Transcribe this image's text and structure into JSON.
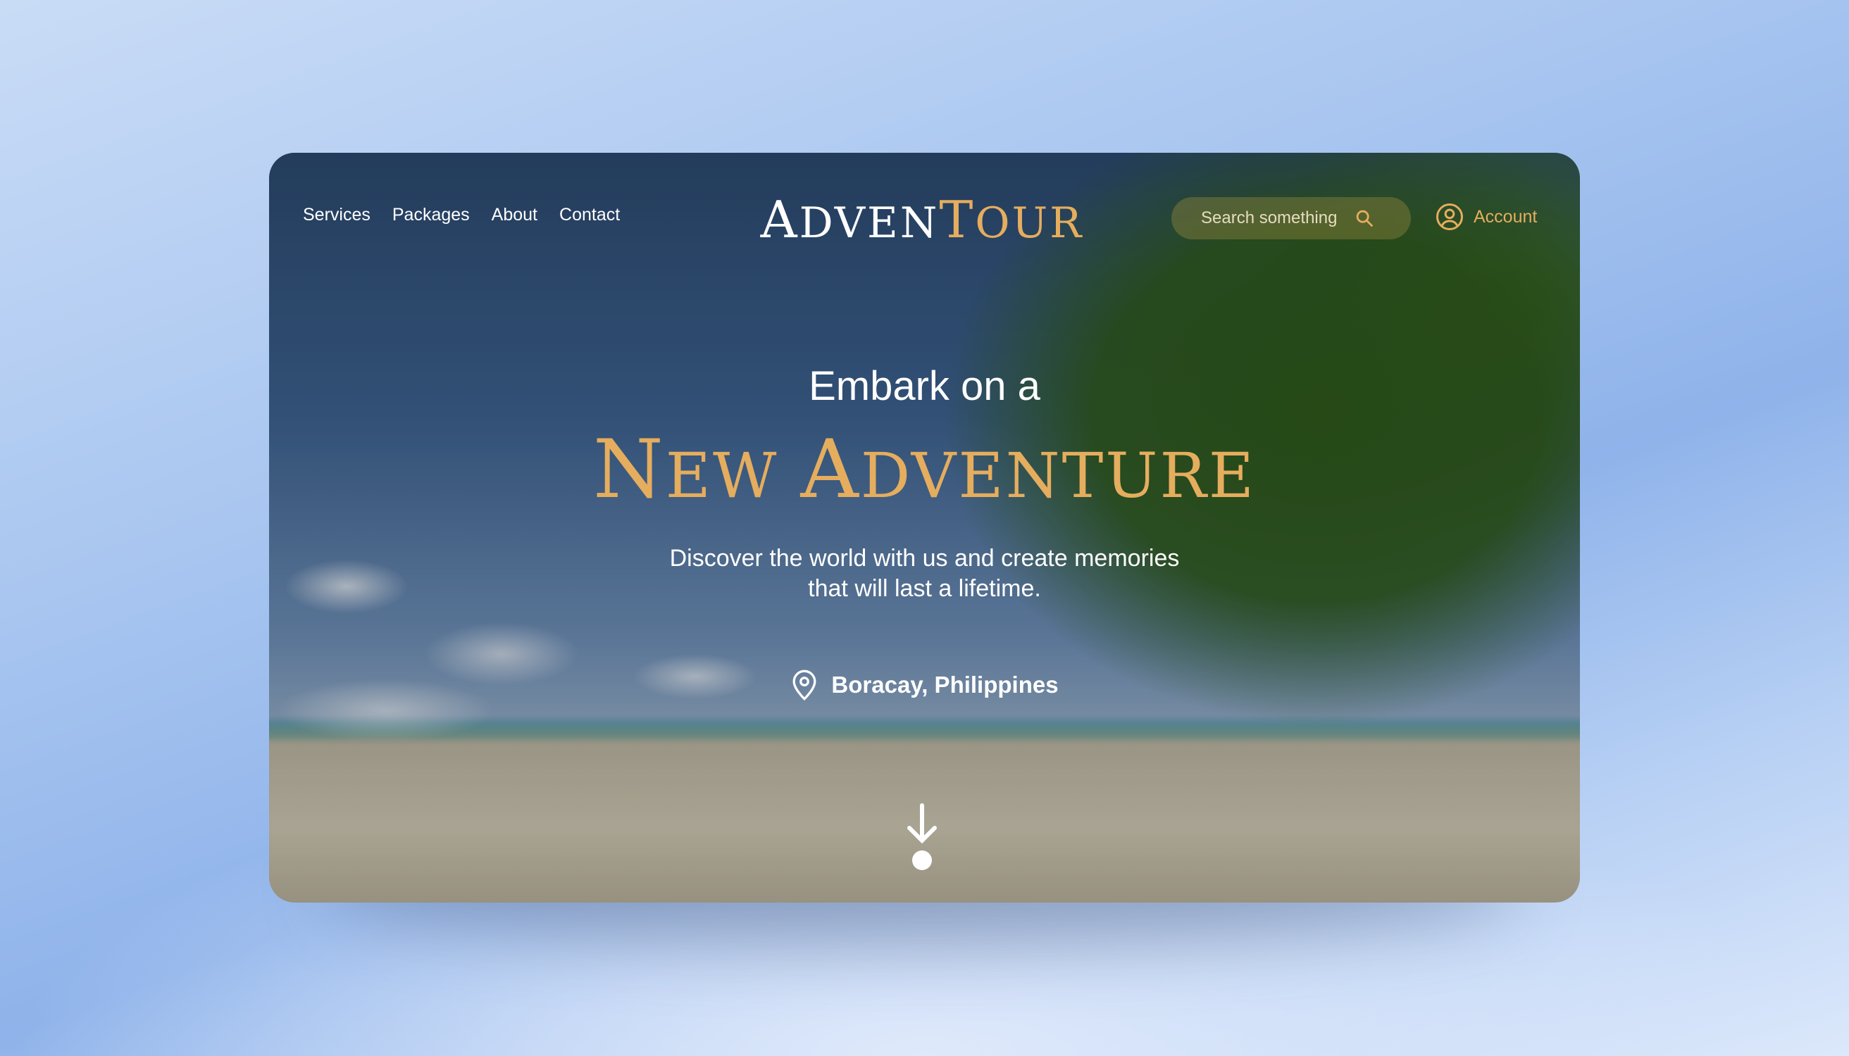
{
  "nav": {
    "items": [
      "Services",
      "Packages",
      "About",
      "Contact"
    ]
  },
  "logo": {
    "part1_initial": "A",
    "part1_rest": "DVEN",
    "part2_initial": "T",
    "part2_rest": "OUR"
  },
  "search": {
    "placeholder": "Search something",
    "icon": "search-icon"
  },
  "account": {
    "label": "Account",
    "icon": "user-circle-icon"
  },
  "hero": {
    "line1": "Embark on a",
    "line2_w1_initial": "N",
    "line2_w1_rest": "EW",
    "line2_w2_initial": "A",
    "line2_w2_rest": "DVENTURE",
    "subtitle_line1": "Discover the world with us and create memories",
    "subtitle_line2": "that will last a lifetime."
  },
  "location": {
    "label": "Boracay, Philippines",
    "icon": "map-pin-icon"
  },
  "scroll": {
    "icon": "arrow-down-icon"
  },
  "colors": {
    "accent": "#e5ad5e",
    "text": "#ffffff"
  }
}
